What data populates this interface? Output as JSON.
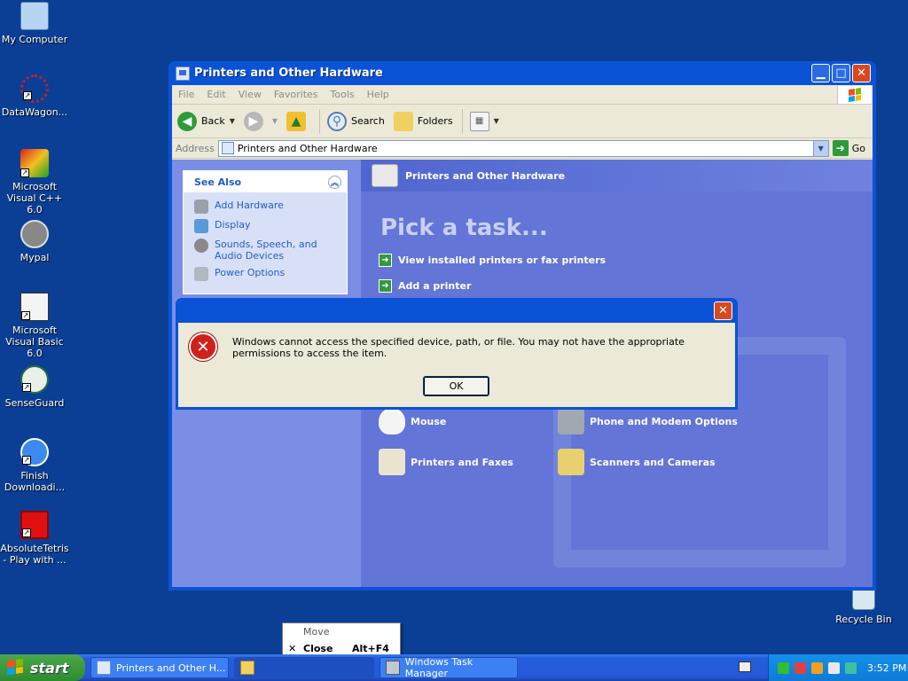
{
  "desktop": {
    "icons": [
      {
        "label": "My Computer"
      },
      {
        "label": "DataWagon..."
      },
      {
        "label": "Microsoft Visual C++ 6.0"
      },
      {
        "label": "Mypal"
      },
      {
        "label": "Microsoft Visual Basic 6.0"
      },
      {
        "label": "SenseGuard"
      },
      {
        "label": "Finish Downloadi..."
      },
      {
        "label": "AbsoluteTetris - Play with ..."
      },
      {
        "label": "Recycle Bin"
      }
    ]
  },
  "window": {
    "title": "Printers and Other Hardware",
    "menu": [
      "File",
      "Edit",
      "View",
      "Favorites",
      "Tools",
      "Help"
    ],
    "toolbar": {
      "back": "Back",
      "search": "Search",
      "folders": "Folders"
    },
    "address": {
      "label": "Address",
      "value": "Printers and Other Hardware",
      "go": "Go"
    },
    "see_also": {
      "title": "See Also",
      "items": [
        "Add Hardware",
        "Display",
        "Sounds, Speech, and Audio Devices",
        "Power Options"
      ]
    },
    "header": "Printers and Other Hardware",
    "pick_task": "Pick a task...",
    "tasks": [
      "View installed printers or fax printers",
      "Add a printer"
    ],
    "categories": [
      "Mouse",
      "Phone and Modem Options",
      "Printers and Faxes",
      "Scanners and Cameras"
    ]
  },
  "dialog": {
    "message": "Windows cannot access the specified device, path, or file.  You may not have the appropriate permissions to access the item.",
    "ok": "OK"
  },
  "context_menu": {
    "items": [
      {
        "label": "Move",
        "shortcut": ""
      },
      {
        "label": "Close",
        "shortcut": "Alt+F4"
      }
    ]
  },
  "taskbar": {
    "start": "start",
    "buttons": [
      "Printers and Other H...",
      "",
      "Windows Task Manager"
    ],
    "clock": "3:52 PM"
  }
}
